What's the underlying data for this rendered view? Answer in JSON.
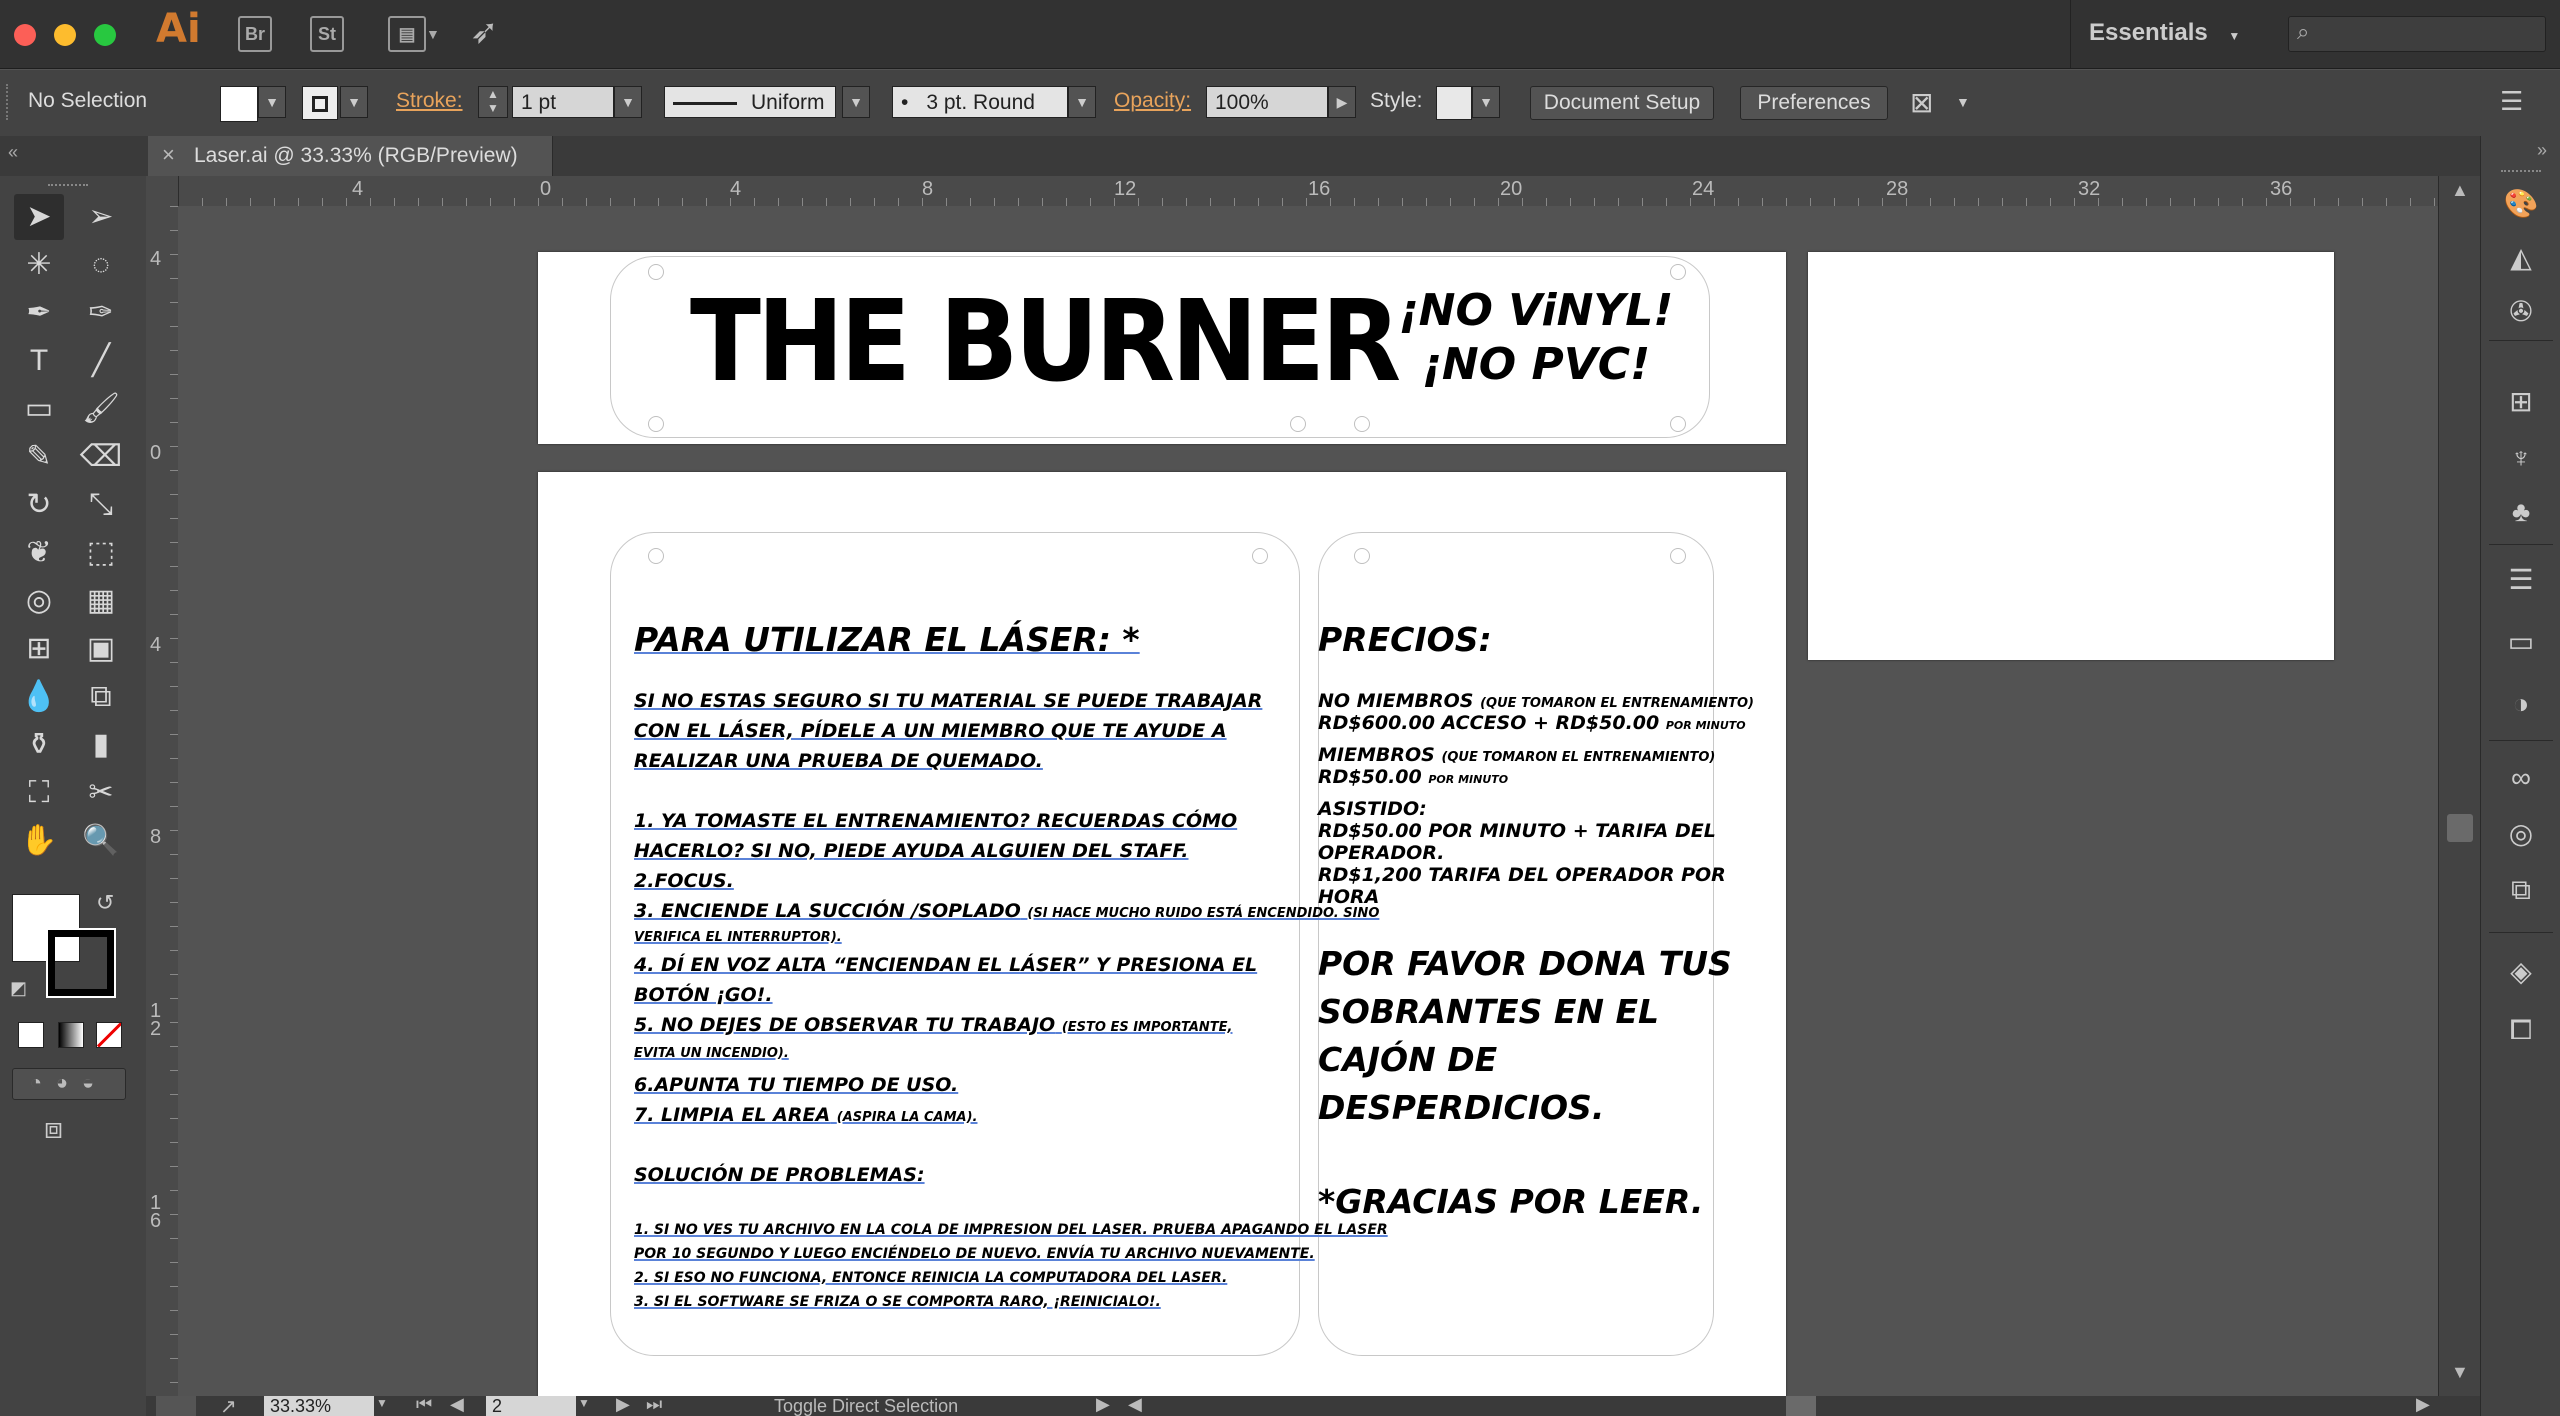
{
  "app": {
    "logo": "Ai",
    "bridge": "Br",
    "stock": "St",
    "workspace": "Essentials"
  },
  "control": {
    "selection": "No Selection",
    "stroke_label": "Stroke:",
    "stroke_weight": "1 pt",
    "profile": "Uniform",
    "brush": "3 pt. Round",
    "opacity_label": "Opacity:",
    "opacity_value": "100%",
    "style_label": "Style:",
    "doc_setup": "Document Setup",
    "preferences": "Preferences"
  },
  "document": {
    "tab_title": "Laser.ai @ 33.33% (RGB/Preview)",
    "close": "×"
  },
  "rulers": {
    "top": [
      "4",
      "0",
      "4",
      "8",
      "12",
      "16",
      "20",
      "24",
      "28",
      "32",
      "36"
    ],
    "left": [
      "4",
      "0",
      "4",
      "8",
      "1\n2",
      "1\n6"
    ]
  },
  "artwork": {
    "title": "THE BURNER",
    "tagline1": "¡NO ViNYL!",
    "tagline2": "¡NO PVC!",
    "instructions_heading": "PARA UTILIZAR EL LÁSER: *",
    "intro": [
      "SI NO ESTAS SEGURO SI TU MATERIAL SE PUEDE TRABAJAR",
      "CON EL LÁSER, PÍDELE A UN MIEMBRO QUE TE AYUDE A",
      "REALIZAR UNA PRUEBA DE QUEMADO."
    ],
    "steps": [
      "1. YA TOMASTE EL ENTRENAMIENTO? RECUERDAS CÓMO",
      "HACERLO? SI NO, PIEDE AYUDA ALGUIEN DEL STAFF.",
      "2.FOCUS.",
      "3. ENCIENDE LA SUCCIÓN /SOPLADO",
      "(SI HACE MUCHO RUIDO ESTÁ ENCENDIDO. SINO",
      "VERIFICA EL INTERRUPTOR).",
      "4. DÍ EN VOZ ALTA “ENCIENDAN EL LÁSER” Y PRESIONA EL",
      "BOTÓN ¡GO!.",
      "5. NO DEJES DE OBSERVAR TU TRABAJO",
      "(ESTO ES IMPORTANTE,",
      "EVITA UN INCENDIO).",
      "6.APUNTA TU TIEMPO DE USO.",
      "7. LIMPIA EL AREA",
      "(ASPIRA LA CAMA)."
    ],
    "troubleshoot_heading": "SOLUCIÓN DE PROBLEMAS:",
    "troubleshoot": [
      "1. SI NO VES TU ARCHIVO EN LA COLA DE IMPRESION DEL LASER.  PRUEBA APAGANDO EL LASER",
      "POR 10 SEGUNDO Y LUEGO ENCIÉNDELO DE NUEVO. ENVÍA TU ARCHIVO NUEVAMENTE.",
      "2. SI ESO NO FUNCIONA, ENTONCE REINICIA LA COMPUTADORA DEL LASER.",
      "3. SI EL SOFTWARE SE FRIZA O SE COMPORTA RARO, ¡REINICIALO!."
    ],
    "prices_heading": "PRECIOS:",
    "prices": {
      "nonmember": "NO MIEMBROS",
      "nonmember_note": "(QUE TOMARON EL ENTRENAMIENTO)",
      "nonmember_price": "RD$600.00 ACCESO + RD$50.00",
      "per_minute": "POR MINUTO",
      "member": "MIEMBROS",
      "member_note": "(QUE TOMARON EL ENTRENAMIENTO)",
      "member_price": "RD$50.00",
      "assisted": "ASISTIDO:",
      "assisted_1": "RD$50.00 POR MINUTO + TARIFA DEL",
      "assisted_2": "OPERADOR.",
      "assisted_3": "RD$1,200 TARIFA DEL OPERADOR POR",
      "assisted_4": "HORA"
    },
    "donate": [
      "POR FAVOR DONA TUS",
      "SOBRANTES EN EL",
      "CAJÓN DE",
      "DESPERDICIOS."
    ],
    "thanks": "*GRACIAS POR LEER."
  },
  "status": {
    "zoom": "33.33%",
    "artboard": "2",
    "tool_hint": "Toggle Direct Selection"
  },
  "colors": {
    "accent_orange": "#d17a2f",
    "link_orange": "#e8a35b",
    "underline_blue": "#5a82d8"
  }
}
